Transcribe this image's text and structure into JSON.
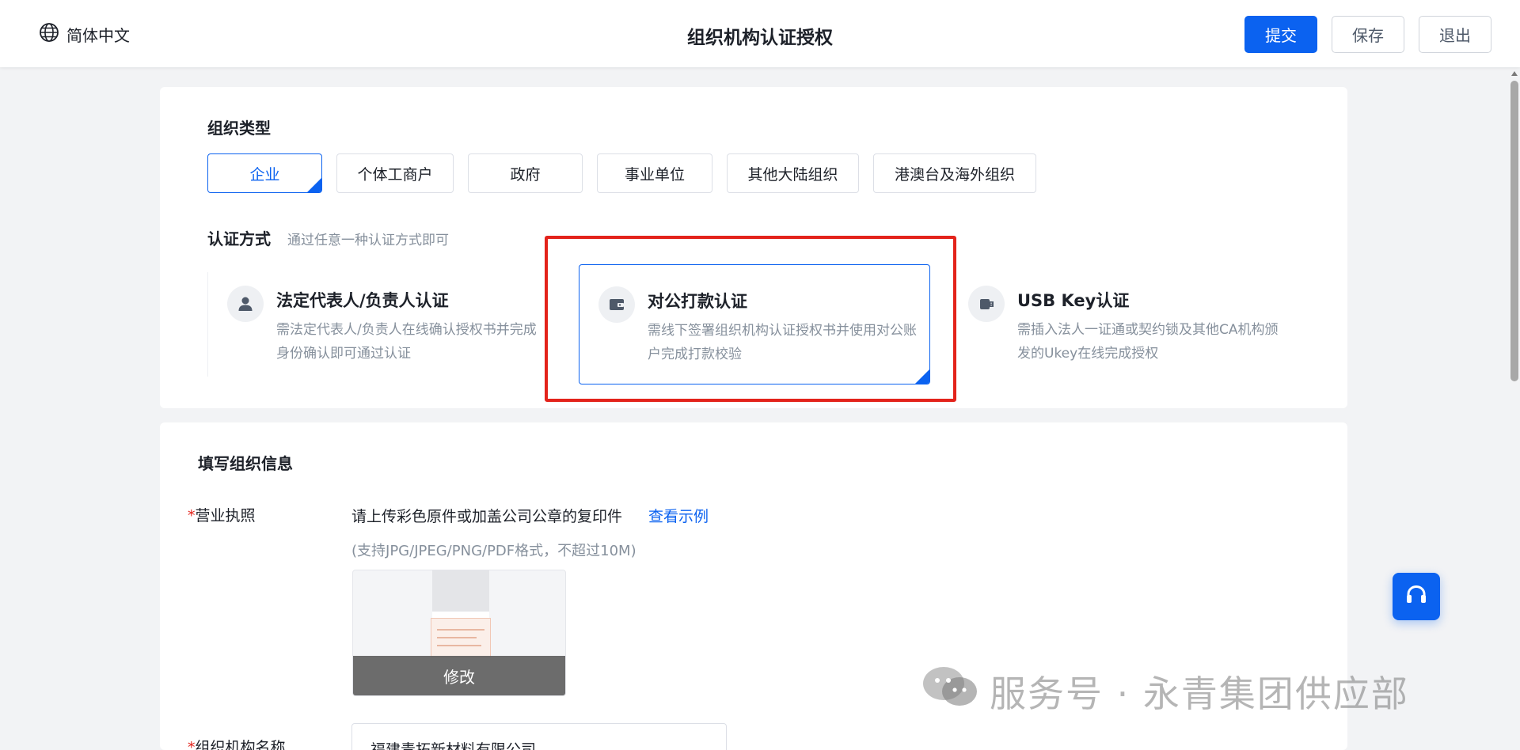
{
  "header": {
    "language": "简体中文",
    "title": "组织机构认证授权",
    "buttons": {
      "submit": "提交",
      "save": "保存",
      "exit": "退出"
    }
  },
  "org_type": {
    "title": "组织类型",
    "selected": "企业",
    "tabs": [
      {
        "label": "企业"
      },
      {
        "label": "个体工商户"
      },
      {
        "label": "政府"
      },
      {
        "label": "事业单位"
      },
      {
        "label": "其他大陆组织"
      },
      {
        "label": "港澳台及海外组织"
      }
    ]
  },
  "auth_method": {
    "title": "认证方式",
    "hint": "通过任意一种认证方式即可",
    "selected": "对公打款认证",
    "options": [
      {
        "icon": "person-icon",
        "title": "法定代表人/负责人认证",
        "desc": "需法定代表人/负责人在线确认授权书并完成身份确认即可通过认证"
      },
      {
        "icon": "wallet-icon",
        "title": "对公打款认证",
        "desc": "需线下签署组织机构认证授权书并使用对公账户完成打款校验"
      },
      {
        "icon": "usb-key-icon",
        "title": "USB Key认证",
        "desc": "需插入法人一证通或契约锁及其他CA机构颁发的Ukey在线完成授权"
      }
    ]
  },
  "org_info": {
    "title": "填写组织信息",
    "license": {
      "required_mark": "*",
      "label": "营业执照",
      "upload_hint": "请上传彩色原件或加盖公司公章的复印件",
      "example_link": "查看示例",
      "format_hint": "(支持JPG/JPEG/PNG/PDF格式，不超过10M)",
      "modify_label": "修改"
    },
    "org_name": {
      "required_mark": "*",
      "label": "组织机构名称",
      "value": "福建青拓新材料有限公司"
    }
  },
  "watermark": {
    "text": "服务号 · 永青集团供应部"
  },
  "colors": {
    "primary": "#0b62f0",
    "highlight": "#e3231b",
    "muted": "#86909c",
    "background": "#f2f3f5"
  }
}
